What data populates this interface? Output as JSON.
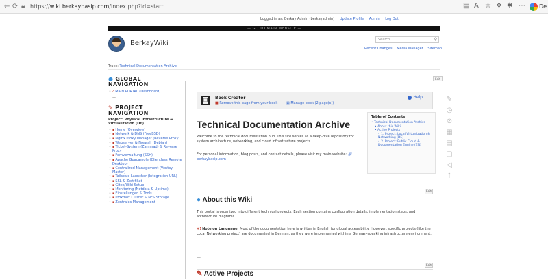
{
  "browser": {
    "url_prefix": "https://",
    "url_host": "wiki.berkaybasip.com",
    "url_path": "/index.php?id=start",
    "owner": "De"
  },
  "userbar": {
    "logged_in": "Logged in as: Berkay Admin (berkayadmin)",
    "update_profile": "Update Profile",
    "admin": "Admin",
    "logout": "Log Out"
  },
  "sitenotice": "— GO TO MAIN WEBSITE —",
  "site": {
    "name": "BerkayWiki"
  },
  "search": {
    "placeholder": "Search"
  },
  "toplinks": [
    "Recent Changes",
    "Media Manager",
    "Sitemap"
  ],
  "breadcrumb": {
    "label": "Trace:",
    "current": "Technical Documentation Archive"
  },
  "edit_tab": "Edit",
  "sidebar": {
    "global_nav": "GLOBAL NAVIGATION",
    "main_portal": "MAIN PORTAL (Dashboard)",
    "dash": "—",
    "project_nav": "PROJECT NAVIGATION",
    "project_title": "Project: Physical Infrastructure & Virtualization (DE)",
    "items": [
      "Home (Overview)",
      "Network & DNS (FreeBSD)",
      "Nginx Proxy Manager (Reverse Proxy)",
      "Webserver & Firewall (Debian)",
      "Ticket-System (Zammad) & Reverse Proxy",
      "Fernverwaltung (SSH)",
      "Apache Guacamole (Clientless Remote Desktop)",
      "Centralized Management (Ventoy Master)",
      "Tailscale Launcher (Integration URL)",
      "SSL & Zertifikat",
      "Gitea/Wiki-Setup",
      "Monitoring (Netdata & Uptime)",
      "Einstellungen & Tools",
      "Proxmox Cluster & NFS Storage",
      "Zentrales Management"
    ]
  },
  "bookcreator": {
    "title": "Book Creator",
    "remove": "Remove this page from your book",
    "manage": "Manage book (2 page(s))",
    "help": "Help"
  },
  "page": {
    "title": "Technical Documentation Archive",
    "intro": "Welcome to the technical documentation hub. This site serves as a deep-dive repository for system architecture, networking, and cloud infrastructure projects.",
    "personal": "For personal information, blog posts, and contact details, please visit my main website:",
    "personal_link": "berkaybasip.com",
    "dash": "—",
    "about_title": "About this Wiki",
    "about_text": "This portal is organized into different technical projects. Each section contains configuration details, implementation steps, and architecture diagrams.",
    "note_label": "Note on Language:",
    "note_text": "Most of the documentation here is written in English for global accessibility. However, specific projects (like the Local Networking project) are documented in German, as they were implemented within a German-speaking infrastructure environment.",
    "dash2": "—",
    "active_title": "Active Projects",
    "edit": "Edit"
  },
  "toc": {
    "title": "Table of Contents",
    "items": [
      {
        "level": 1,
        "text": "Technical Documentation Archive"
      },
      {
        "level": 2,
        "text": "About this Wiki"
      },
      {
        "level": 2,
        "text": "Active Projects"
      },
      {
        "level": 3,
        "text": "1. Project: Local Virtualization & Networking (DE)"
      },
      {
        "level": 3,
        "text": "2. Project: Public Cloud & Documentation Engine (EN)"
      }
    ]
  },
  "tools": [
    "pencil-icon",
    "history-icon",
    "link-icon",
    "pdf-icon",
    "copy-icon",
    "export-icon",
    "send-icon",
    "top-icon"
  ]
}
